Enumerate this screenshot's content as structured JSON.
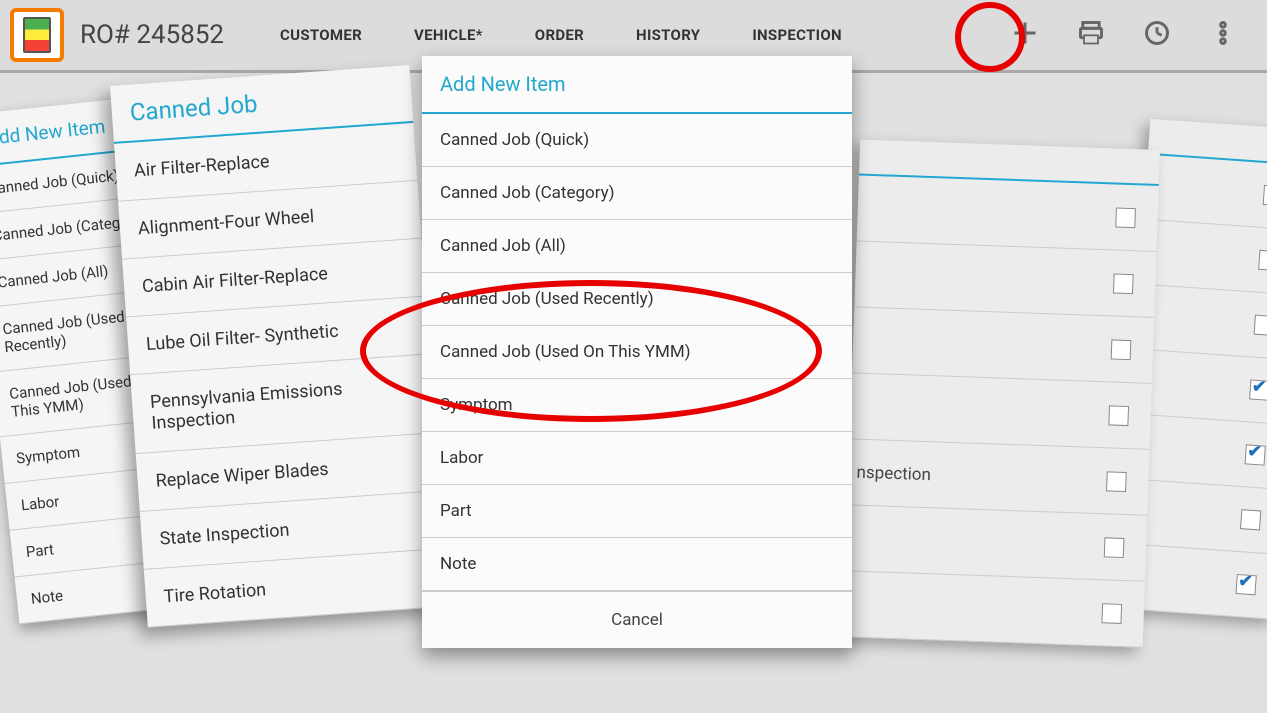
{
  "header": {
    "ro_label": "RO# 245852",
    "tabs": [
      "CUSTOMER",
      "VEHICLE*",
      "ORDER",
      "HISTORY",
      "INSPECTION"
    ]
  },
  "back_left": {
    "title": "Add New Item",
    "items": [
      "Canned Job (Quick)",
      "Canned Job (Category)",
      "Canned Job (All)",
      "Canned Job (Used Recently)",
      "Canned Job (Used On This YMM)",
      "Symptom",
      "Labor",
      "Part",
      "Note"
    ]
  },
  "mid_left": {
    "title": "Canned Job",
    "items": [
      "Air Filter-Replace",
      "Alignment-Four Wheel",
      "Cabin Air Filter-Replace",
      "Lube Oil Filter- Synthetic",
      "Pennsylvania Emissions Inspection",
      "Replace Wiper Blades",
      "State Inspection",
      "Tire Rotation"
    ]
  },
  "center": {
    "title": "Add New Item",
    "items": [
      "Canned Job (Quick)",
      "Canned Job (Category)",
      "Canned Job (All)",
      "Canned Job (Used Recently)",
      "Canned Job (Used On This YMM)",
      "Symptom",
      "Labor",
      "Part",
      "Note"
    ],
    "cancel": "Cancel"
  },
  "right_front": {
    "rows": [
      {
        "label": "",
        "checked": false
      },
      {
        "label": "",
        "checked": false
      },
      {
        "label": "",
        "checked": false
      },
      {
        "label": "",
        "checked": false
      },
      {
        "label": "nspection",
        "checked": false
      },
      {
        "label": "",
        "checked": false
      },
      {
        "label": "",
        "checked": false
      }
    ]
  },
  "right_back": {
    "rows": [
      {
        "checked": false
      },
      {
        "checked": false
      },
      {
        "checked": false
      },
      {
        "checked": true
      },
      {
        "checked": true
      },
      {
        "checked": false
      },
      {
        "checked": true
      }
    ]
  }
}
